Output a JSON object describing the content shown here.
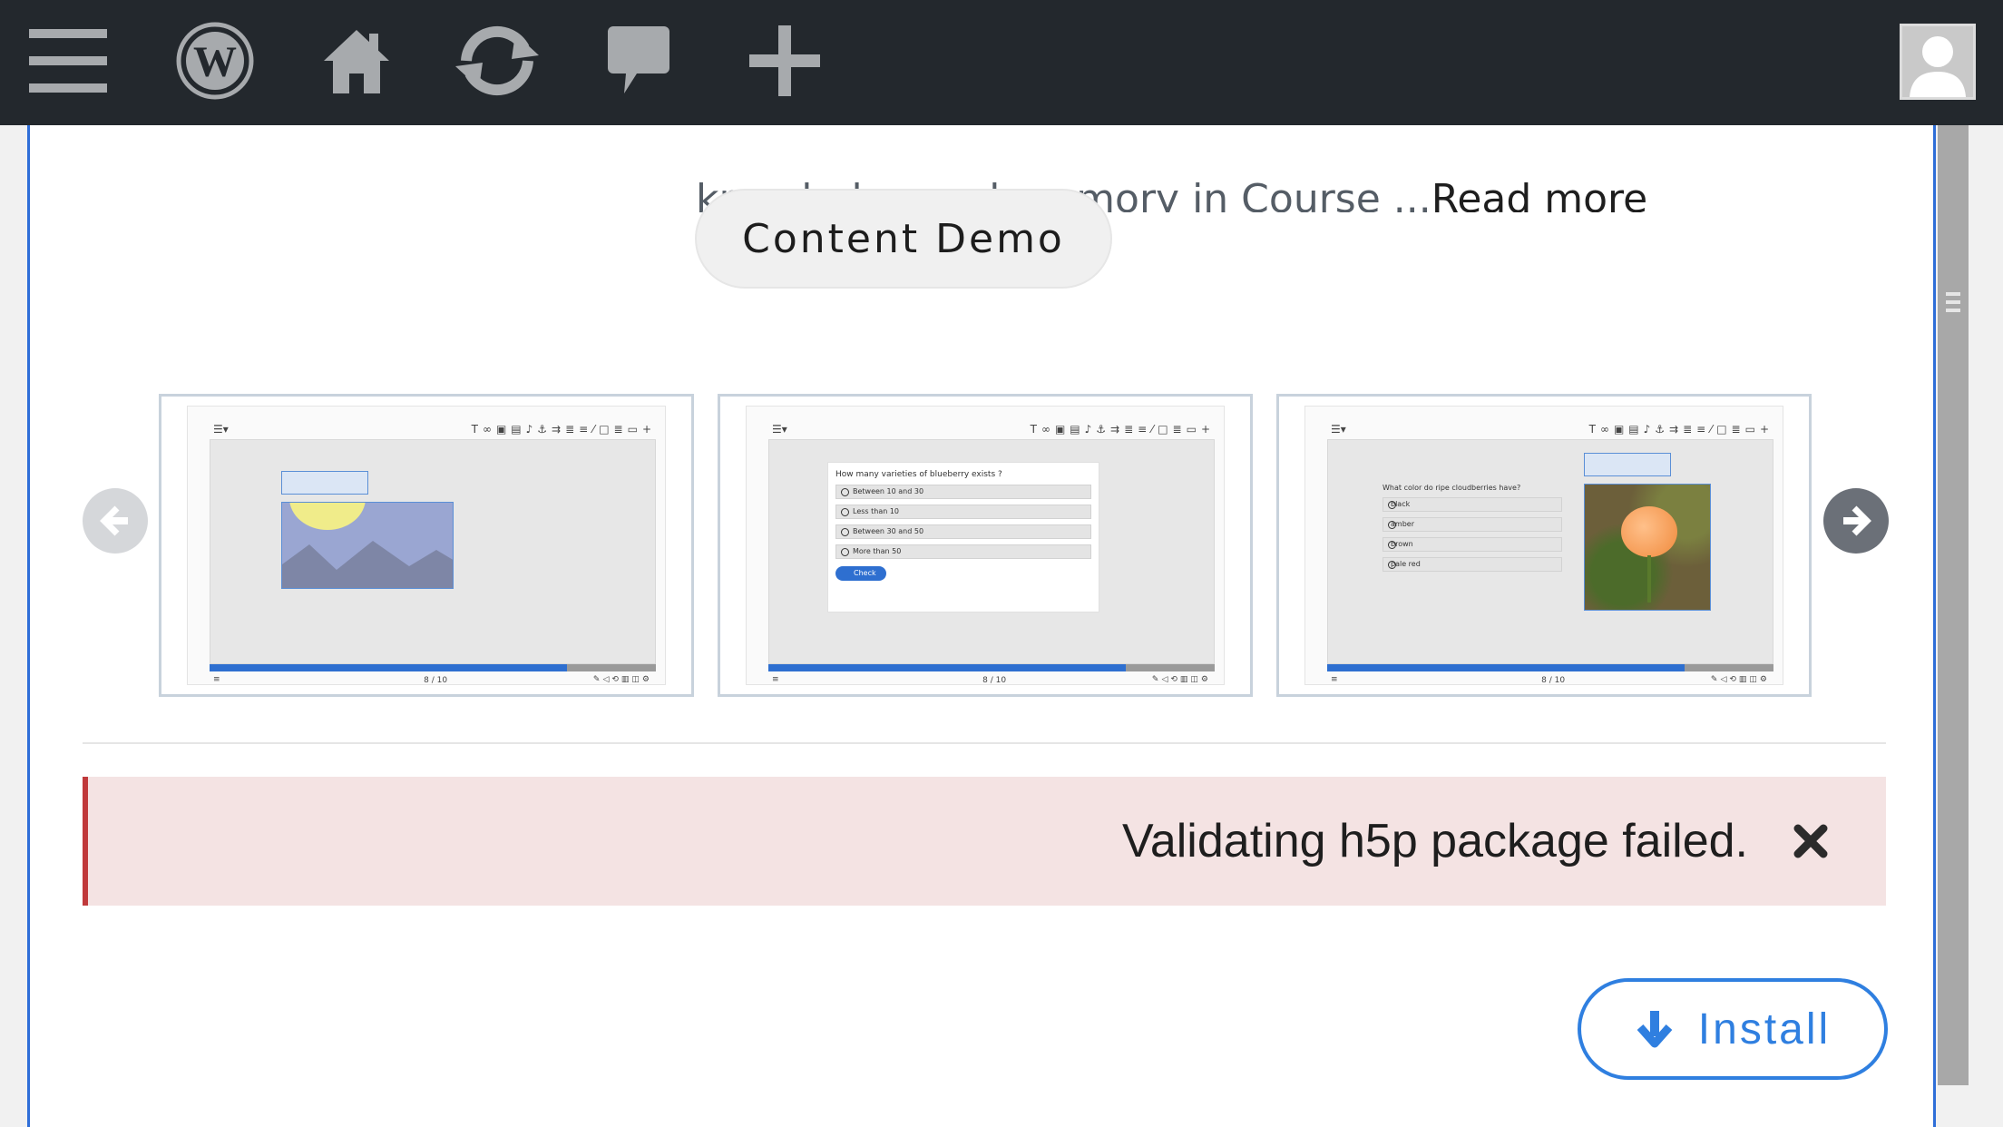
{
  "adminbar": {
    "icons": [
      "menu-icon",
      "wordpress-logo-icon",
      "home-icon",
      "updates-icon",
      "comments-icon",
      "new-content-icon"
    ],
    "avatar_icon": "user-avatar-icon",
    "bg_color": "#23282d"
  },
  "description": {
    "text": "knowledge and memory in Course ...",
    "read_more": "Read more"
  },
  "content_demo": {
    "label": "Content Demo"
  },
  "carousel": {
    "prev_icon": "arrow-left-icon",
    "next_icon": "arrow-right-icon",
    "screenshots": [
      {
        "kind": "image-editing",
        "pager": "8 / 10"
      },
      {
        "kind": "multiple-choice",
        "question": "How many varieties of blueberry exists ?",
        "options": [
          "Between 10 and 30",
          "Less than 10",
          "Between 30 and 50",
          "More than 50"
        ],
        "check_label": "Check",
        "pager": "8 / 10"
      },
      {
        "kind": "image-question",
        "question": "What color do ripe cloudberries have?",
        "options": [
          "black",
          "amber",
          "brown",
          "pale red"
        ],
        "pager": "8 / 10"
      }
    ]
  },
  "notice": {
    "message": "Validating h5p package failed.",
    "close_icon": "close-icon",
    "border_color": "#c0393b",
    "bg_color": "#f4e3e3"
  },
  "install": {
    "label": "Install",
    "icon": "download-arrow-icon",
    "color": "#2f7fe0"
  }
}
